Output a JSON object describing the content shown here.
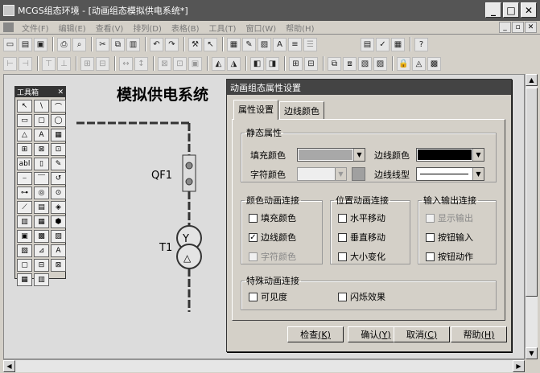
{
  "window": {
    "title": "MCGS组态环境 - [动画组态模拟供电系统*]",
    "buttons": [
      "_",
      "□",
      "✕"
    ]
  },
  "menu": [
    "文件(F)",
    "编辑(E)",
    "查看(V)",
    "排列(D)",
    "表格(B)",
    "工具(T)",
    "窗口(W)",
    "帮助(H)"
  ],
  "canvas": {
    "title": "模拟供电系统",
    "qf_label": "QF1",
    "t_label": "T1"
  },
  "toolbox": {
    "title": "工具箱",
    "close": "✕",
    "tools": [
      "↖",
      "\\",
      "⌒",
      "▭",
      "▢",
      "◯",
      "△",
      "A",
      "▦",
      "⊞",
      "⊠",
      "⊡",
      "abl",
      "▯",
      "✎",
      "⎯",
      "⎺",
      "↺",
      "⊶",
      "◎",
      "⊙",
      "⟋",
      "▤",
      "◈",
      "▥",
      "▦",
      "⬢",
      "▣",
      "▩",
      "▨",
      "▧",
      "⊿",
      "A",
      "▢",
      "⊟",
      "⊠",
      "▦",
      "▥"
    ]
  },
  "dialog": {
    "title": "动画组态属性设置",
    "tabs": [
      "属性设置",
      "边线颜色"
    ],
    "static_group": "静态属性",
    "fill_color_label": "填充颜色",
    "line_color_label": "边线颜色",
    "text_color_label": "字符颜色",
    "line_style_label": "边线线型",
    "colors": {
      "fill": "#a8a8a8",
      "line": "#000000",
      "text_swatch": "#a0a0a0"
    },
    "color_group": "颜色动画连接",
    "color_items": [
      {
        "label": "填充颜色",
        "checked": false,
        "disabled": false
      },
      {
        "label": "边线颜色",
        "checked": true,
        "disabled": false
      },
      {
        "label": "字符颜色",
        "checked": false,
        "disabled": true
      }
    ],
    "pos_group": "位置动画连接",
    "pos_items": [
      {
        "label": "水平移动",
        "checked": false
      },
      {
        "label": "垂直移动",
        "checked": false
      },
      {
        "label": "大小变化",
        "checked": false
      }
    ],
    "io_group": "输入输出连接",
    "io_items": [
      {
        "label": "显示输出",
        "checked": false,
        "disabled": true
      },
      {
        "label": "按钮输入",
        "checked": false,
        "disabled": false
      },
      {
        "label": "按钮动作",
        "checked": false,
        "disabled": false
      }
    ],
    "special_group": "特殊动画连接",
    "special_items": [
      {
        "label": "可见度",
        "checked": false
      },
      {
        "label": "闪烁效果",
        "checked": false
      }
    ],
    "buttons": {
      "check": "检查",
      "check_key": "(K)",
      "ok": "确认",
      "ok_key": "(Y)",
      "cancel": "取消",
      "cancel_key": "(C)",
      "help": "帮助",
      "help_key": "(H)"
    }
  }
}
